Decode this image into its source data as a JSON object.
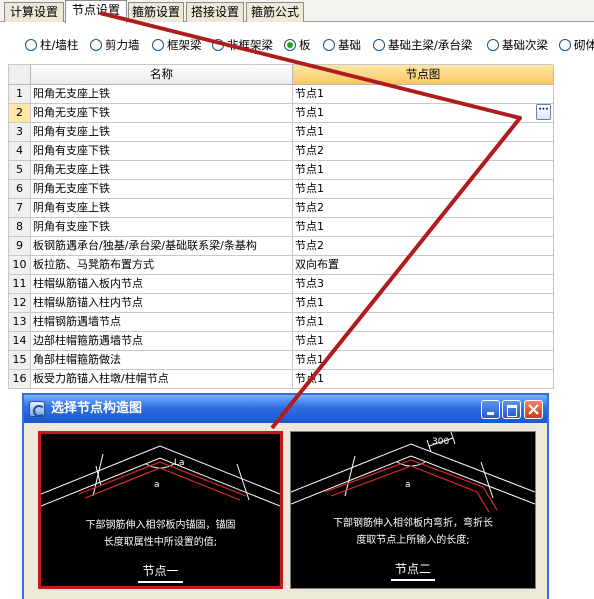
{
  "tabs": [
    {
      "label": "计算设置",
      "active": false
    },
    {
      "label": "节点设置",
      "active": true
    },
    {
      "label": "箍筋设置",
      "active": false
    },
    {
      "label": "搭接设置",
      "active": false
    },
    {
      "label": "箍筋公式",
      "active": false
    }
  ],
  "radio_options": [
    {
      "label": "柱/墙柱",
      "checked": false
    },
    {
      "label": "剪力墙",
      "checked": false
    },
    {
      "label": "框架梁",
      "checked": false
    },
    {
      "label": "非框架梁",
      "checked": false
    },
    {
      "label": "板",
      "checked": true
    },
    {
      "label": "基础",
      "checked": false
    },
    {
      "label": "基础主梁/承台梁",
      "checked": false
    },
    {
      "label": "基础次梁",
      "checked": false
    },
    {
      "label": "砌体",
      "checked": false
    }
  ],
  "grid": {
    "columns": {
      "name": "名称",
      "node": "节点图"
    },
    "selected_row": 2,
    "rows": [
      {
        "num": "1",
        "name": "阳角无支座上铁",
        "node": "节点1"
      },
      {
        "num": "2",
        "name": "阳角无支座下铁",
        "node": "节点1"
      },
      {
        "num": "3",
        "name": "阳角有支座上铁",
        "node": "节点1"
      },
      {
        "num": "4",
        "name": "阳角有支座下铁",
        "node": "节点2"
      },
      {
        "num": "5",
        "name": "阴角无支座上铁",
        "node": "节点1"
      },
      {
        "num": "6",
        "name": "阴角无支座下铁",
        "node": "节点1"
      },
      {
        "num": "7",
        "name": "阴角有支座上铁",
        "node": "节点2"
      },
      {
        "num": "8",
        "name": "阴角有支座下铁",
        "node": "节点1"
      },
      {
        "num": "9",
        "name": "板钢筋遇承台/独基/承台梁/基础联系梁/条基构",
        "node": "节点2"
      },
      {
        "num": "10",
        "name": "板拉筋、马凳筋布置方式",
        "node": "双向布置"
      },
      {
        "num": "11",
        "name": "柱帽纵筋锚入板内节点",
        "node": "节点3"
      },
      {
        "num": "12",
        "name": "柱帽纵筋锚入柱内节点",
        "node": "节点1"
      },
      {
        "num": "13",
        "name": "柱帽钢筋遇墙节点",
        "node": "节点1"
      },
      {
        "num": "14",
        "name": "边部柱帽箍筋遇墙节点",
        "node": "节点1"
      },
      {
        "num": "15",
        "name": "角部柱帽箍筋做法",
        "node": "节点1"
      },
      {
        "num": "16",
        "name": "板受力筋锚入柱墩/柱帽节点",
        "node": "节点1"
      }
    ],
    "ellipsis_label": "···"
  },
  "dialog": {
    "title": "选择节点构造图",
    "nodes": [
      {
        "label": "节点一",
        "desc": "下部钢筋伸入相邻板内锚固，锚固\n长度取属性中所设置的值;",
        "selected": true,
        "fig_a": "a",
        "fig_la": "La",
        "fig_dim": ""
      },
      {
        "label": "节点二",
        "desc": "下部钢筋伸入相邻板内弯折，弯折长\n度取节点上所输入的长度;",
        "selected": false,
        "fig_a": "a",
        "fig_la": "",
        "fig_dim": "300"
      }
    ]
  },
  "colors": {
    "annotation": "#b01c1c",
    "selected_border": "#c4191f",
    "titlebar": "#2f6ee3",
    "header_highlight": "#f9c860"
  }
}
